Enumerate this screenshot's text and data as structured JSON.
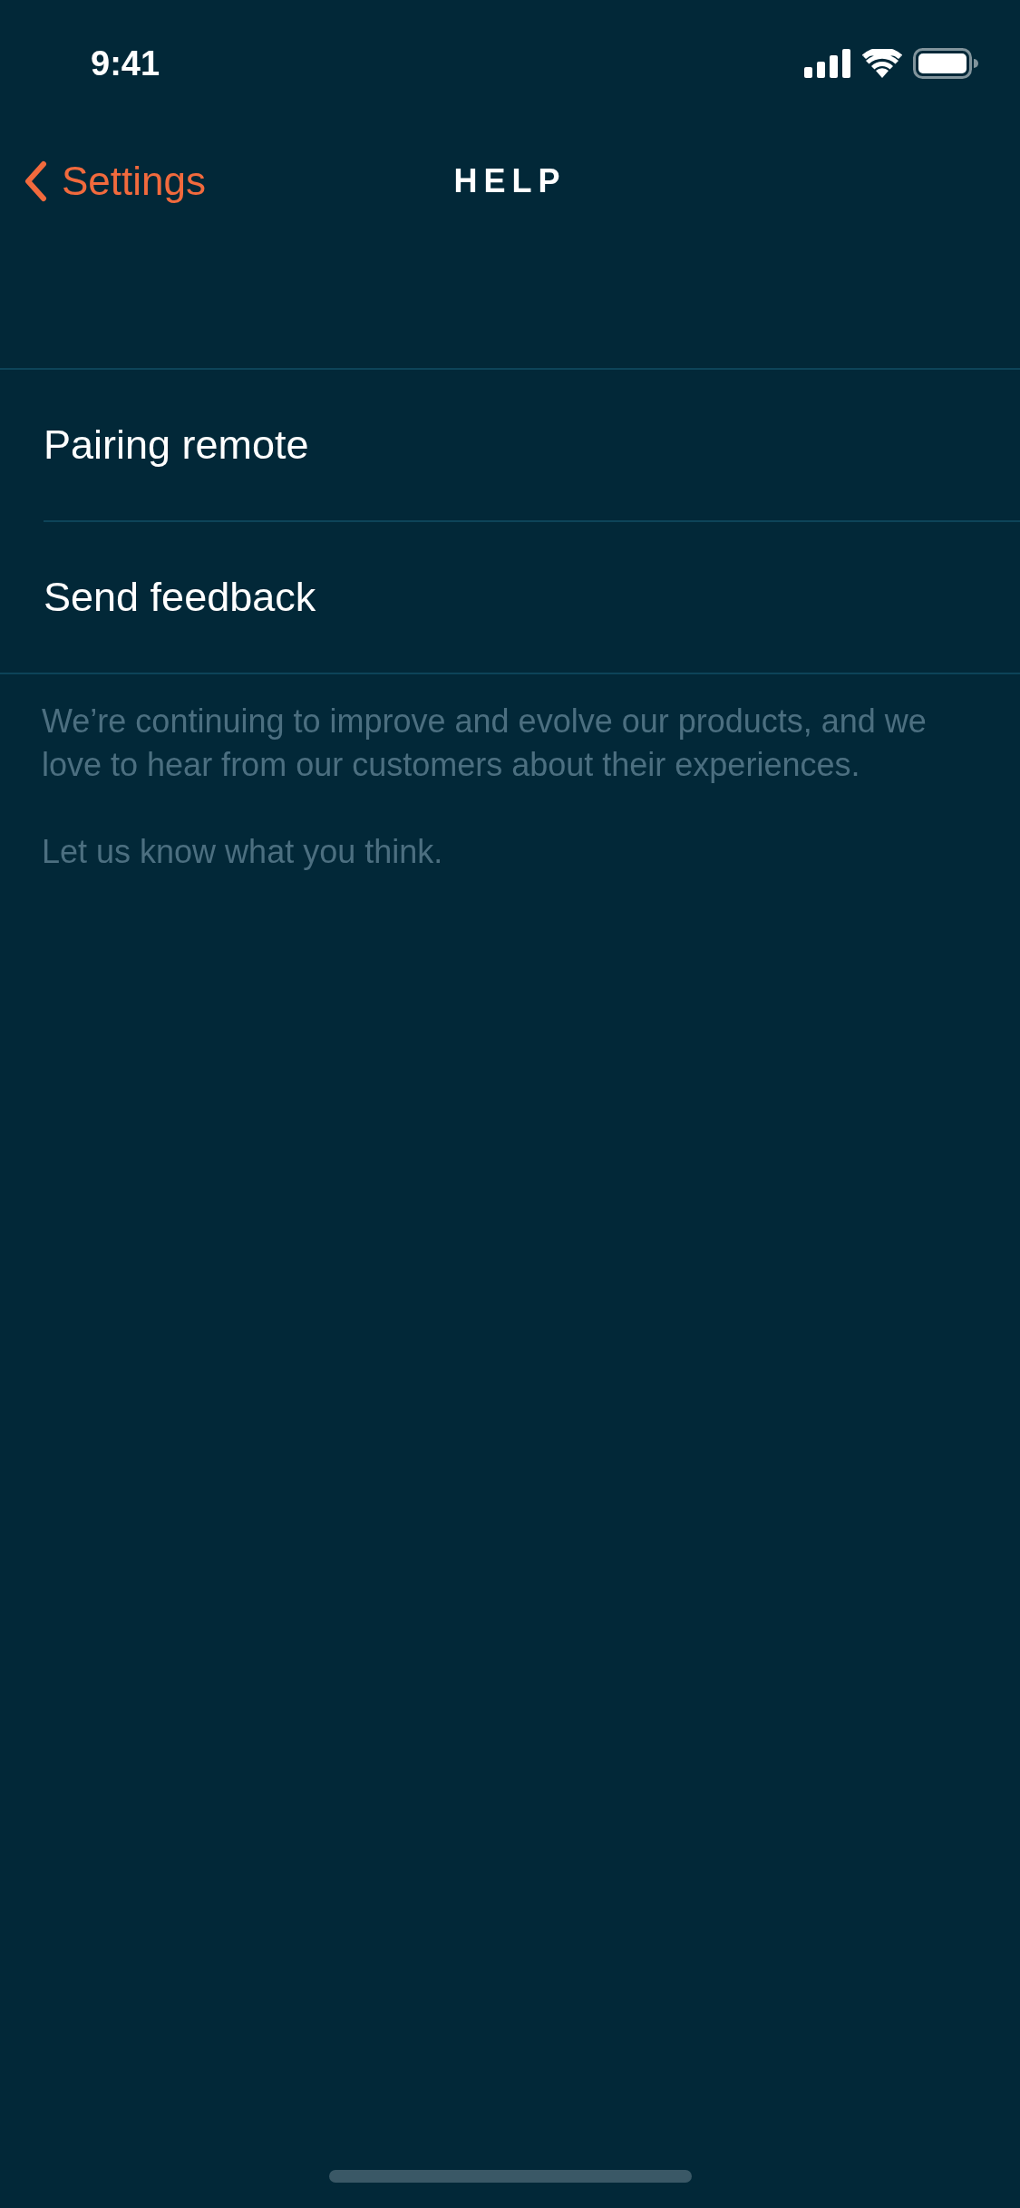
{
  "status_bar": {
    "time": "9:41"
  },
  "nav": {
    "back_label": "Settings",
    "title": "HELP"
  },
  "items": [
    {
      "label": "Pairing remote"
    },
    {
      "label": "Send feedback"
    }
  ],
  "footer": [
    "We’re continuing to improve and evolve our products, and we love to hear from our customers about their experiences.",
    "Let us know what you think."
  ]
}
